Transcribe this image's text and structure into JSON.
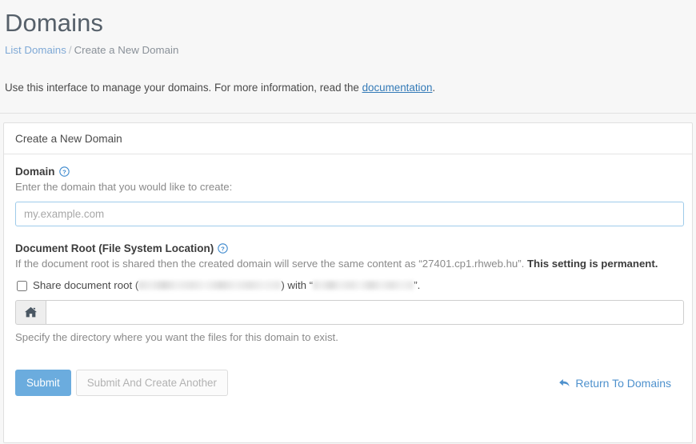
{
  "header": {
    "title": "Domains",
    "breadcrumb": {
      "parent": "List Domains",
      "separator": "/",
      "current": "Create a New Domain"
    },
    "intro_before": "Use this interface to manage your domains. For more information, read the ",
    "intro_link": "documentation",
    "intro_after": "."
  },
  "card": {
    "title": "Create a New Domain",
    "domain_field": {
      "label": "Domain",
      "help_icon": "question-circle-icon",
      "hint": "Enter the domain that you would like to create:",
      "value": "",
      "placeholder": "my.example.com"
    },
    "docroot_field": {
      "label": "Document Root (File System Location)",
      "help_icon": "question-circle-icon",
      "note_before": "If the document root is shared then the created domain will serve the same content as “",
      "note_domain": "27401.cp1.rhweb.hu",
      "note_middle": "”. ",
      "note_bold": "This setting is permanent.",
      "share_checkbox": {
        "checked": false,
        "text_before": "Share document root (",
        "redacted_path": "",
        "text_middle": ") with “",
        "redacted_domain": "",
        "text_after": "”."
      },
      "addon_icon": "home-icon",
      "value": "",
      "placeholder": "",
      "hint": "Specify the directory where you want the files for this domain to exist."
    }
  },
  "actions": {
    "submit_label": "Submit",
    "submit_another_label": "Submit And Create Another",
    "return_label": "Return To Domains",
    "return_icon": "reply-arrow-icon"
  },
  "colors": {
    "primary": "#6bacde",
    "link": "#337ab7",
    "page_bg": "#f7f7f7",
    "card_bg": "#ffffff",
    "muted_text": "#8a8a8a"
  }
}
